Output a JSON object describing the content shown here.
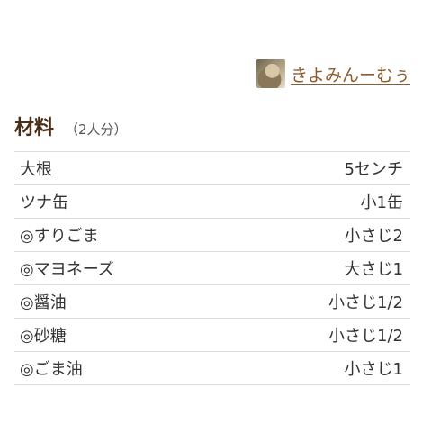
{
  "author": {
    "name": "きよみんーむぅ"
  },
  "recipe": {
    "title": "材料",
    "servings": "（2人分）"
  },
  "ingredients": [
    {
      "name": "大根",
      "qty": "5センチ"
    },
    {
      "name": "ツナ缶",
      "qty": "小1缶"
    },
    {
      "name": "◎すりごま",
      "qty": "小さじ2"
    },
    {
      "name": "◎マヨネーズ",
      "qty": "大さじ1"
    },
    {
      "name": "◎醤油",
      "qty": "小さじ1/2"
    },
    {
      "name": "◎砂糖",
      "qty": "小さじ1/2"
    },
    {
      "name": "◎ごま油",
      "qty": "小さじ1"
    }
  ]
}
